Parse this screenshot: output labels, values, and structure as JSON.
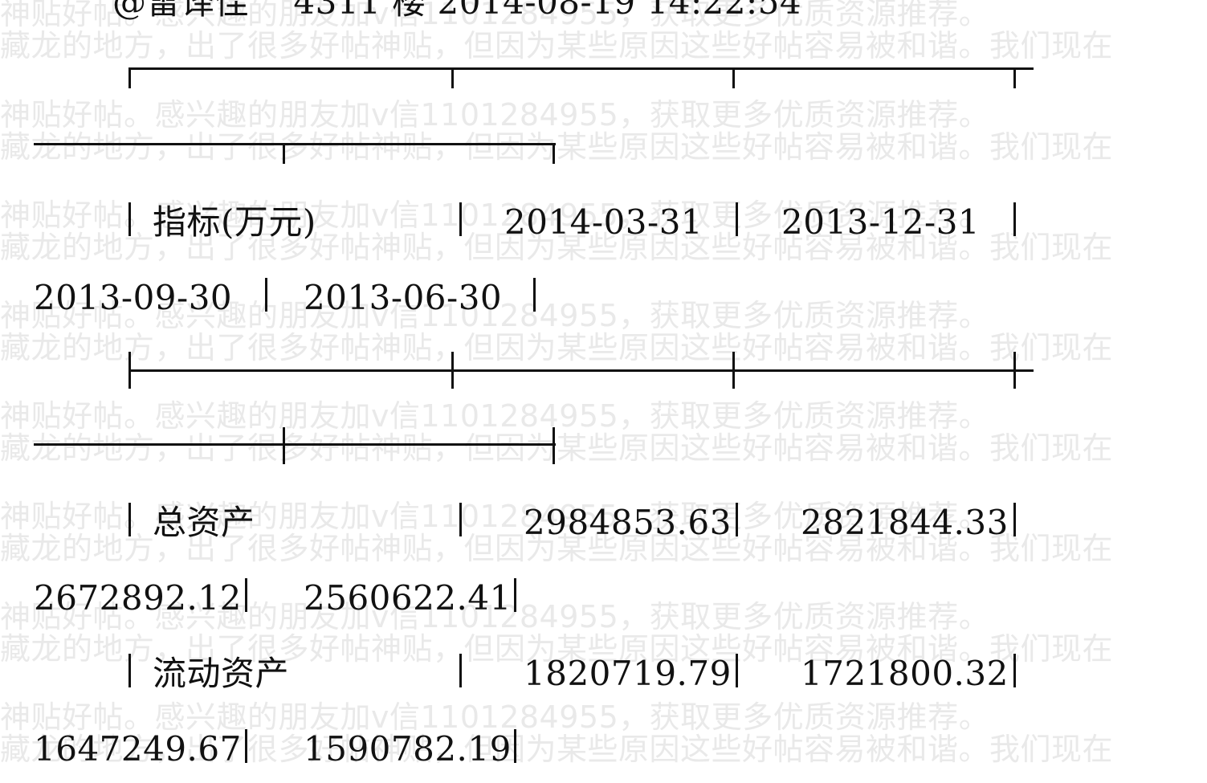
{
  "header_fragment": "@雷译佳    4311 楼 2014-08-19 14:22:54",
  "watermark": {
    "line_a": "神贴好帖。感兴趣的朋友加v信1101284955，获取更多优质资源推荐。",
    "line_b": "藏龙的地方，出了很多好帖神贴，但因为某些原因这些好帖容易被和谐。我们现在"
  },
  "table": {
    "header": {
      "label": "指标(万元)",
      "col1": "2014-03-31",
      "col2": "2013-12-31",
      "col3": "2013-09-30",
      "col4": "2013-06-30"
    },
    "rows": [
      {
        "label": "总资产",
        "col1": "2984853.63",
        "col2": "2821844.33",
        "col3": "2672892.12",
        "col4": "2560622.41"
      },
      {
        "label": "流动资产",
        "col1": "1820719.79",
        "col2": "1721800.32",
        "col3": "1647249.67",
        "col4": "1590782.19"
      }
    ]
  }
}
